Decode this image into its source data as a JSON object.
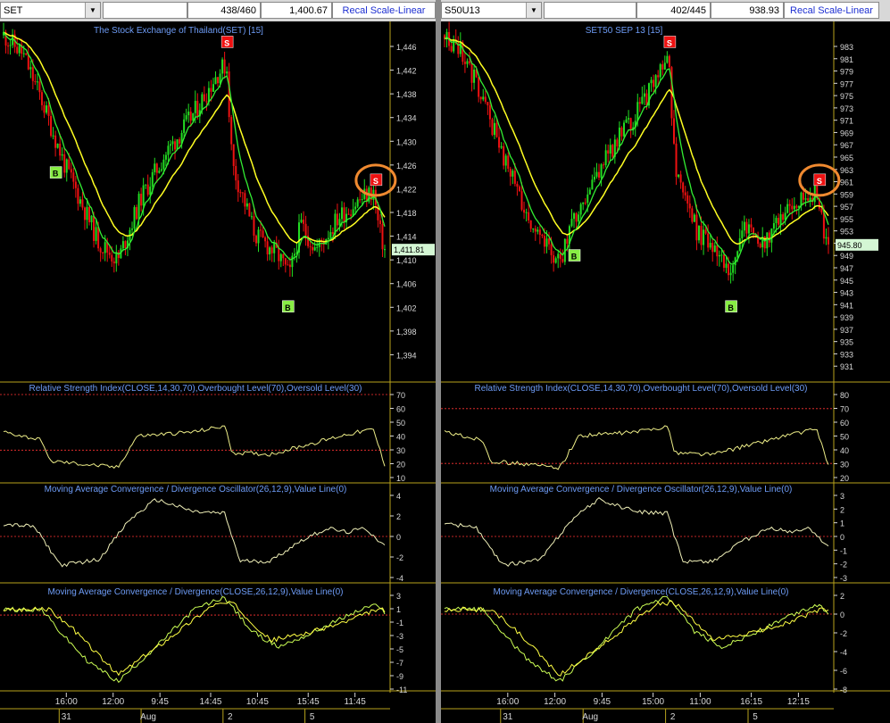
{
  "colors": {
    "up": "#22dd22",
    "down": "#ee1111",
    "ma_fast": "#33ee33",
    "ma_slow": "#ffff22",
    "title": "#6e9cf6",
    "axis_text": "#d8d8d8",
    "level_line": "#ff3333",
    "signal_buy": "#88ee44",
    "signal_sell": "#ee1111",
    "highlight_circle": "#f08a30",
    "border": "#b8a21c"
  },
  "panels": [
    {
      "symbol": "SET",
      "count": "438/460",
      "last_value": "1,400.67",
      "recal_label": "Recal Scale-Linear",
      "price_title": "The Stock Exchange of Thailand(SET) [15]",
      "price_ticks": [
        "1,446",
        "1,442",
        "1,438",
        "1,434",
        "1,430",
        "1,426",
        "1,422",
        "1,418",
        "1,414",
        "1,410",
        "1,406",
        "1,402",
        "1,398",
        "1,394"
      ],
      "current_price": "1,411.81",
      "rsi_title": "Relative Strength Index(CLOSE,14,30,70),Overbought Level(70),Oversold Level(30)",
      "rsi_ticks": [
        "70",
        "60",
        "50",
        "40",
        "30",
        "20",
        "10"
      ],
      "osc_title": "Moving Average Convergence / Divergence Oscillator(26,12,9),Value Line(0)",
      "osc_ticks": [
        "4",
        "2",
        "0",
        "-2",
        "-4"
      ],
      "macd_title": "Moving Average Convergence / Divergence(CLOSE,26,12,9),Value Line(0)",
      "macd_ticks": [
        "3",
        "1",
        "-1",
        "-3",
        "-5",
        "-7",
        "-9",
        "-11"
      ],
      "time_labels": [
        "16:00",
        "12:00",
        "9:45",
        "14:45",
        "10:45",
        "15:45",
        "11:45"
      ],
      "date_labels": [
        "31",
        "Aug",
        "2",
        "5"
      ],
      "signals": [
        {
          "label": "B",
          "type": "buy",
          "x": 0.135
        },
        {
          "label": "S",
          "type": "sell",
          "x": 0.585
        },
        {
          "label": "B",
          "type": "buy",
          "x": 0.745
        },
        {
          "label": "S",
          "type": "sell",
          "x": 0.978,
          "circled": true
        }
      ]
    },
    {
      "symbol": "S50U13",
      "count": "402/445",
      "last_value": "938.93",
      "recal_label": "Recal Scale-Linear",
      "price_title": "SET50 SEP 13   [15]",
      "price_ticks": [
        "983",
        "981",
        "979",
        "977",
        "975",
        "973",
        "971",
        "969",
        "967",
        "965",
        "963",
        "961",
        "959",
        "957",
        "955",
        "953",
        "951",
        "949",
        "947",
        "945",
        "943",
        "941",
        "939",
        "937",
        "935",
        "933",
        "931"
      ],
      "current_price": "945.80",
      "rsi_title": "Relative Strength Index(CLOSE,14,30,70),Overbought Level(70),Oversold Level(30)",
      "rsi_ticks": [
        "80",
        "70",
        "60",
        "50",
        "40",
        "30",
        "20"
      ],
      "osc_title": "Moving Average Convergence / Divergence Oscillator(26,12,9),Value Line(0)",
      "osc_ticks": [
        "3",
        "2",
        "1",
        "0",
        "-1",
        "-2",
        "-3"
      ],
      "macd_title": "Moving Average Convergence / Divergence(CLOSE,26,12,9),Value Line(0)",
      "macd_ticks": [
        "2",
        "0",
        "-2",
        "-4",
        "-6",
        "-8"
      ],
      "time_labels": [
        "16:00",
        "12:00",
        "9:45",
        "15:00",
        "11:00",
        "16:15",
        "12:15"
      ],
      "date_labels": [
        "31",
        "Aug",
        "2",
        "5"
      ],
      "signals": [
        {
          "label": "B",
          "type": "buy",
          "x": 0.335
        },
        {
          "label": "S",
          "type": "sell",
          "x": 0.585
        },
        {
          "label": "B",
          "type": "buy",
          "x": 0.745
        },
        {
          "label": "S",
          "type": "sell",
          "x": 0.978,
          "circled": true
        }
      ]
    }
  ]
}
